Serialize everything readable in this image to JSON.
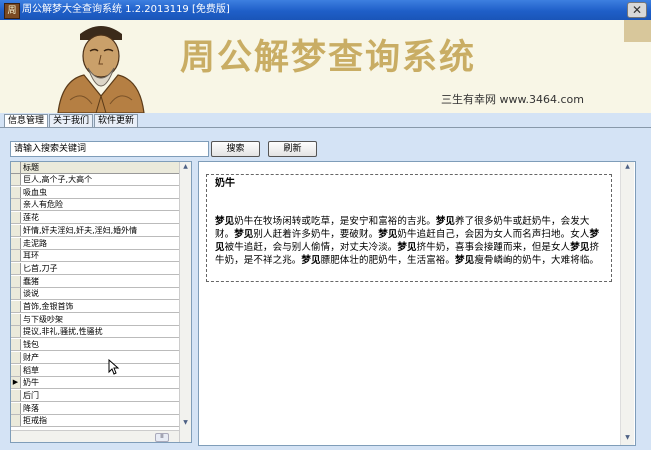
{
  "window": {
    "title": "周公解梦大全查询系统 1.2.2013119 [免费版]",
    "close_glyph": "✕",
    "app_icon_glyph": "周"
  },
  "banner": {
    "title": "周公解梦查询系统",
    "subtitle": "三生有幸网 www.3464.com"
  },
  "tabs": [
    {
      "label": "信息管理"
    },
    {
      "label": "关于我们"
    },
    {
      "label": "软件更新"
    }
  ],
  "search": {
    "value": "请输入搜索关键词",
    "search_button": "搜索",
    "refresh_button": "刷新"
  },
  "grid": {
    "header": "标题",
    "selected_marker": "▶",
    "scroll_up": "▲",
    "scroll_down": "▼",
    "hthumb_glyph": "Ⅲ",
    "rows": [
      "巨人,高个子,大高个",
      "吸血虫",
      "亲人有危险",
      "莲花",
      "奸情,奸夫淫妇,奸夫,淫妇,婚外情",
      "走泥路",
      "耳环",
      "匕首,刀子",
      "蠢猪",
      "谈说",
      "首饰,金银首饰",
      "与下级吵架",
      "提议,非礼,骚扰,性骚扰",
      "钱包",
      "财产",
      "稻草",
      "奶牛",
      "后门",
      "降落",
      "拒戒指"
    ],
    "selected_index": 16
  },
  "detail": {
    "title": "奶牛",
    "paragraph": [
      {
        "t": "梦见",
        "b": true
      },
      {
        "t": "奶牛在牧场闲转或吃草，是安宁和富裕的吉兆。"
      },
      {
        "t": "梦见",
        "b": true
      },
      {
        "t": "养了很多奶牛或赶奶牛，会发大财。"
      },
      {
        "t": "梦见",
        "b": true
      },
      {
        "t": "别人赶着许多奶牛，要破财。"
      },
      {
        "t": "梦见",
        "b": true
      },
      {
        "t": "奶牛追赶自己，会因为女人而名声扫地。女人"
      },
      {
        "t": "梦见",
        "b": true
      },
      {
        "t": "被牛追赶，会与别人偷情，对丈夫冷淡。"
      },
      {
        "t": "梦见",
        "b": true
      },
      {
        "t": "挤牛奶，喜事会接踵而来，但是女人"
      },
      {
        "t": "梦见",
        "b": true
      },
      {
        "t": "挤牛奶，是不祥之兆。"
      },
      {
        "t": "梦见",
        "b": true
      },
      {
        "t": "膘肥体壮的肥奶牛，生活富裕。"
      },
      {
        "t": "梦见",
        "b": true
      },
      {
        "t": "瘦骨嶙峋的奶牛，大难将临。"
      }
    ]
  },
  "colors": {
    "titlebar": "#1f5fc8",
    "banner_bg": "#f8f6e6",
    "banner_title": "#c9ad64",
    "window_bg": "#d4e3f5"
  }
}
